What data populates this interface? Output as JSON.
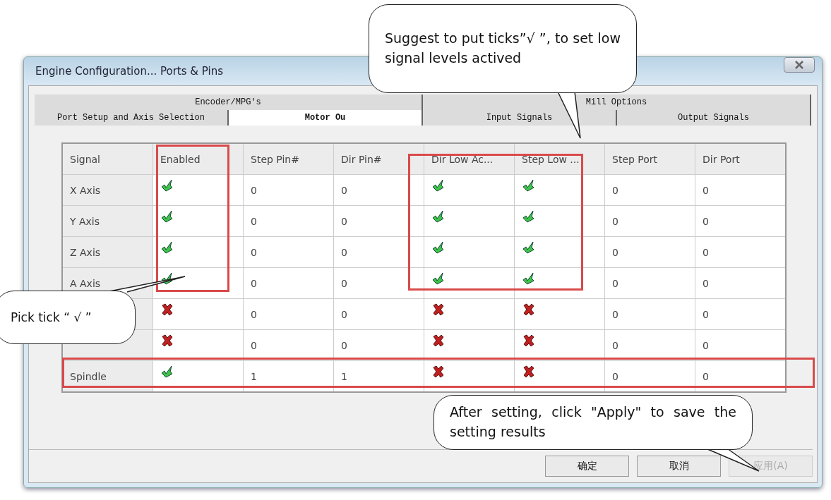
{
  "window": {
    "title": "Engine Configuration... Ports & Pins"
  },
  "tabs": [
    [
      {
        "label": "Encoder/MPG's",
        "selected": false
      },
      {
        "label": "Mill Options",
        "selected": false
      }
    ],
    [
      {
        "label": "Port Setup and Axis Selection",
        "selected": false
      },
      {
        "label": "Motor Ou",
        "selected": true
      },
      {
        "label": "Input Signals",
        "selected": false
      },
      {
        "label": "Output Signals",
        "selected": false
      }
    ]
  ],
  "table": {
    "columns": [
      "Signal",
      "Enabled",
      "Step Pin#",
      "Dir Pin#",
      "Dir Low Ac...",
      "Step Low ...",
      "Step Port",
      "Dir Port"
    ],
    "rows": [
      {
        "signal": "X Axis",
        "enabled": true,
        "step_pin": "0",
        "dir_pin": "0",
        "dir_low": true,
        "step_low": true,
        "step_port": "0",
        "dir_port": "0"
      },
      {
        "signal": "Y Axis",
        "enabled": true,
        "step_pin": "0",
        "dir_pin": "0",
        "dir_low": true,
        "step_low": true,
        "step_port": "0",
        "dir_port": "0"
      },
      {
        "signal": "Z Axis",
        "enabled": true,
        "step_pin": "0",
        "dir_pin": "0",
        "dir_low": true,
        "step_low": true,
        "step_port": "0",
        "dir_port": "0"
      },
      {
        "signal": "A Axis",
        "enabled": true,
        "step_pin": "0",
        "dir_pin": "0",
        "dir_low": true,
        "step_low": true,
        "step_port": "0",
        "dir_port": "0"
      },
      {
        "enabled": false,
        "step_pin": "0",
        "dir_pin": "0",
        "dir_low": false,
        "step_low": false,
        "step_port": "0",
        "dir_port": "0"
      },
      {
        "enabled": false,
        "step_pin": "0",
        "dir_pin": "0",
        "dir_low": false,
        "step_low": false,
        "step_port": "0",
        "dir_port": "0"
      },
      {
        "signal": "Spindle",
        "enabled": true,
        "step_pin": "1",
        "dir_pin": "1",
        "dir_low": false,
        "step_low": false,
        "step_port": "0",
        "dir_port": "0"
      }
    ]
  },
  "buttons": [
    {
      "label": "确定",
      "disabled": false
    },
    {
      "label": "取消",
      "disabled": false
    },
    {
      "label": "应用(A)",
      "disabled": true
    }
  ],
  "annotations": [
    {
      "kind": "top",
      "text": "Suggest to put ticks”√ ”, to set low signal levels actived"
    },
    {
      "kind": "left",
      "text": "Pick tick “ √ ”"
    },
    {
      "kind": "bottom",
      "text": "After setting, click \"Apply\" to save the setting results"
    }
  ]
}
